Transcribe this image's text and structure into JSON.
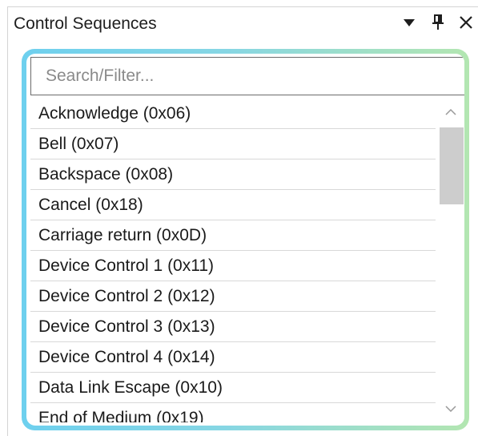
{
  "panel": {
    "title": "Control Sequences",
    "buttons": {
      "dropdown": "▼",
      "pin": "pin-icon",
      "close": "✕"
    }
  },
  "search": {
    "placeholder": "Search/Filter...",
    "value": ""
  },
  "list": {
    "items": [
      "Acknowledge (0x06)",
      "Bell (0x07)",
      "Backspace (0x08)",
      "Cancel (0x18)",
      "Carriage return (0x0D)",
      "Device Control 1 (0x11)",
      "Device Control 2 (0x12)",
      "Device Control 3 (0x13)",
      "Device Control 4 (0x14)",
      "Data Link Escape (0x10)",
      "End of Medium (0x19)"
    ]
  },
  "colors": {
    "frame_gradient_start": "#6ed0ee",
    "frame_gradient_end": "#b3e6b1",
    "scroll_thumb": "#cdcdcd"
  }
}
